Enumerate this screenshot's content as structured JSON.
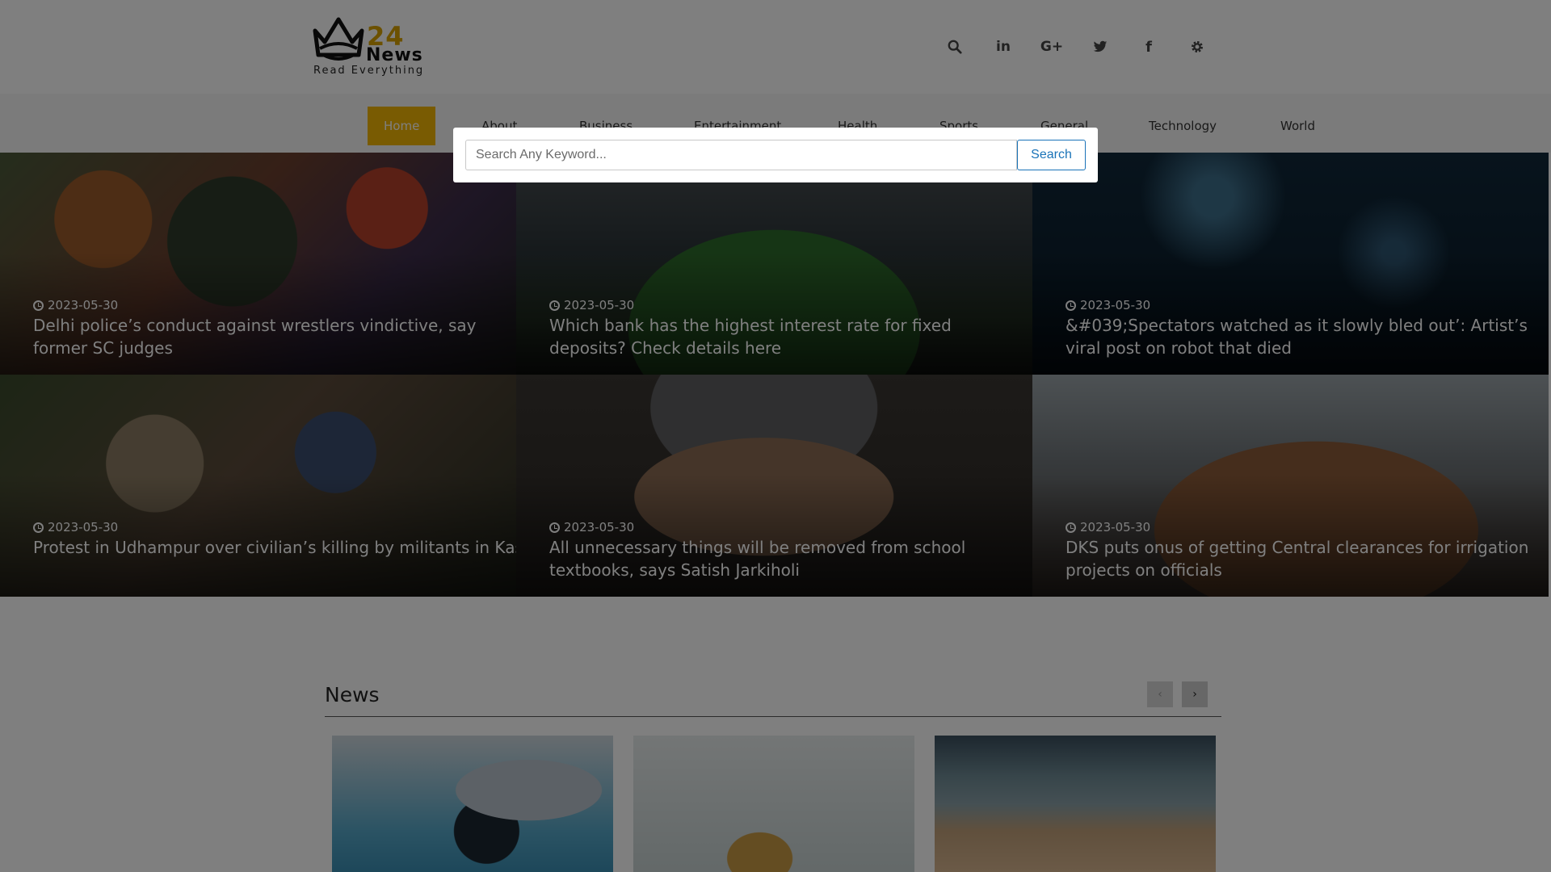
{
  "brand": {
    "number": "24",
    "word": "News",
    "tagline": "Read Everything",
    "accent_color": "#d8a200"
  },
  "header_icons": [
    "search-icon",
    "linkedin-icon",
    "google-plus-icon",
    "twitter-icon",
    "facebook-icon",
    "gear-icon"
  ],
  "nav": {
    "items": [
      {
        "label": "Home",
        "active": true
      },
      {
        "label": "About"
      },
      {
        "label": "Business"
      },
      {
        "label": "Entertainment"
      },
      {
        "label": "Health"
      },
      {
        "label": "Sports"
      },
      {
        "label": "General"
      },
      {
        "label": "Technology"
      },
      {
        "label": "World"
      }
    ],
    "active_color": "#f2b705"
  },
  "hero": {
    "tiles": [
      {
        "date": "2023-05-30",
        "title": "Delhi police’s conduct against wrestlers vindictive, say former SC judges"
      },
      {
        "date": "2023-05-30",
        "title": "Which bank has the highest interest rate for fixed deposits? Check details here"
      },
      {
        "date": "2023-05-30",
        "title": "&#039;Spectators watched as it slowly bled out’: Artist’s viral post on robot that died"
      },
      {
        "date": "2023-05-30",
        "title": "Protest in Udhampur over civilian’s killing by militants in Kashmir"
      },
      {
        "date": "2023-05-30",
        "title": "All unnecessary things will be removed from school textbooks, says Satish Jarkiholi"
      },
      {
        "date": "2023-05-30",
        "title": "DKS puts onus of getting Central clearances for irrigation projects on officials"
      }
    ]
  },
  "news_section": {
    "title": "News",
    "prev_label": "‹",
    "next_label": "›"
  },
  "search_modal": {
    "placeholder": "Search Any Keyword...",
    "button_label": "Search",
    "button_color": "#1a73b8"
  }
}
